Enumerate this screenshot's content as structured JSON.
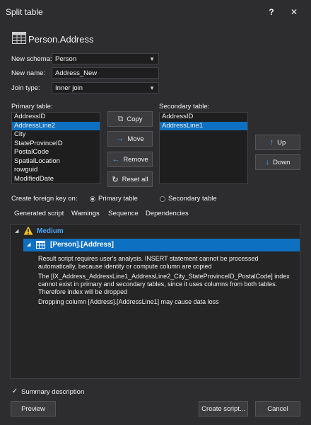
{
  "window": {
    "title": "Split table",
    "help": "?",
    "close": "✕"
  },
  "header": {
    "table_name": "Person.Address"
  },
  "form": {
    "schema_label": "New schema:",
    "schema_value": "Person",
    "name_label": "New name:",
    "name_value": "Address_New",
    "join_label": "Join type:",
    "join_value": "Inner join"
  },
  "primary": {
    "label": "Primary table:",
    "items": [
      "AddressID",
      "AddressLine2",
      "City",
      "StateProvinceID",
      "PostalCode",
      "SpatialLocation",
      "rowguid",
      "ModifiedDate"
    ],
    "selected_index": 1
  },
  "secondary": {
    "label": "Secondary table:",
    "items": [
      "AddressID",
      "AddressLine1"
    ],
    "selected_index": 1
  },
  "buttons": {
    "copy": "Copy",
    "move": "Move",
    "remove": "Remove",
    "reset": "Reset all",
    "up": "Up",
    "down": "Down"
  },
  "fk": {
    "label": "Create foreign key on:",
    "primary": "Primary table",
    "secondary": "Secondary table",
    "selected": "primary"
  },
  "tabs": [
    "Generated script",
    "Warnings",
    "Sequence",
    "Dependencies"
  ],
  "active_tab": "Warnings",
  "warnings": {
    "group": "Medium",
    "object": "[Person].[Address]",
    "messages": [
      "Result script requires user's analysis. INSERT statement cannot be processed automatically, because identity or compute column are copied",
      "The [IX_Address_AddressLine1_AddressLine2_City_StateProvinceID_PostalCode] index cannot exist in primary and secondary tables, since it uses columns from both tables. Therefore index will be dropped",
      "Dropping column [Address].[AddressLine1] may cause data loss"
    ]
  },
  "summary": {
    "label": "Summary description",
    "checked": true
  },
  "footer": {
    "preview": "Preview",
    "create": "Create script...",
    "cancel": "Cancel"
  },
  "colors": {
    "accent": "#0e70c0",
    "background": "#2d2d30",
    "field": "#1e1e1e",
    "icon_blue": "#4ca6f5",
    "warning": "#f5c518"
  }
}
